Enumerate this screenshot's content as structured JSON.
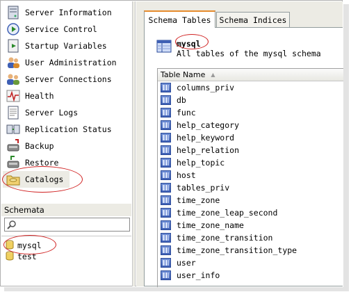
{
  "nav": {
    "items": [
      {
        "label": "Server Information",
        "icon": "server-info-icon"
      },
      {
        "label": "Service Control",
        "icon": "service-control-icon"
      },
      {
        "label": "Startup Variables",
        "icon": "startup-variables-icon"
      },
      {
        "label": "User Administration",
        "icon": "users-icon"
      },
      {
        "label": "Server Connections",
        "icon": "connections-icon"
      },
      {
        "label": "Health",
        "icon": "health-icon"
      },
      {
        "label": "Server Logs",
        "icon": "logs-icon"
      },
      {
        "label": "Replication Status",
        "icon": "replication-icon"
      },
      {
        "label": "Backup",
        "icon": "backup-icon"
      },
      {
        "label": "Restore",
        "icon": "restore-icon"
      },
      {
        "label": "Catalogs",
        "icon": "catalogs-icon",
        "selected": true
      }
    ]
  },
  "schemata": {
    "header": "Schemata",
    "search_value": "",
    "items": [
      {
        "label": "mysql",
        "selected": true
      },
      {
        "label": "test"
      }
    ]
  },
  "tabs": [
    {
      "label": "Schema Tables",
      "active": true
    },
    {
      "label": "Schema Indices"
    }
  ],
  "schema_panel": {
    "title": "mysql",
    "description": "All tables of the mysql schema"
  },
  "tables": {
    "column_header": "Table Name",
    "sort_indicator": "▲",
    "rows": [
      "columns_priv",
      "db",
      "func",
      "help_category",
      "help_keyword",
      "help_relation",
      "help_topic",
      "host",
      "tables_priv",
      "time_zone",
      "time_zone_leap_second",
      "time_zone_name",
      "time_zone_transition",
      "time_zone_transition_type",
      "user",
      "user_info"
    ]
  },
  "colors": {
    "annotation": "#d02020",
    "panel_bg": "#ecebe4",
    "tab_highlight": "#e68b2c"
  }
}
